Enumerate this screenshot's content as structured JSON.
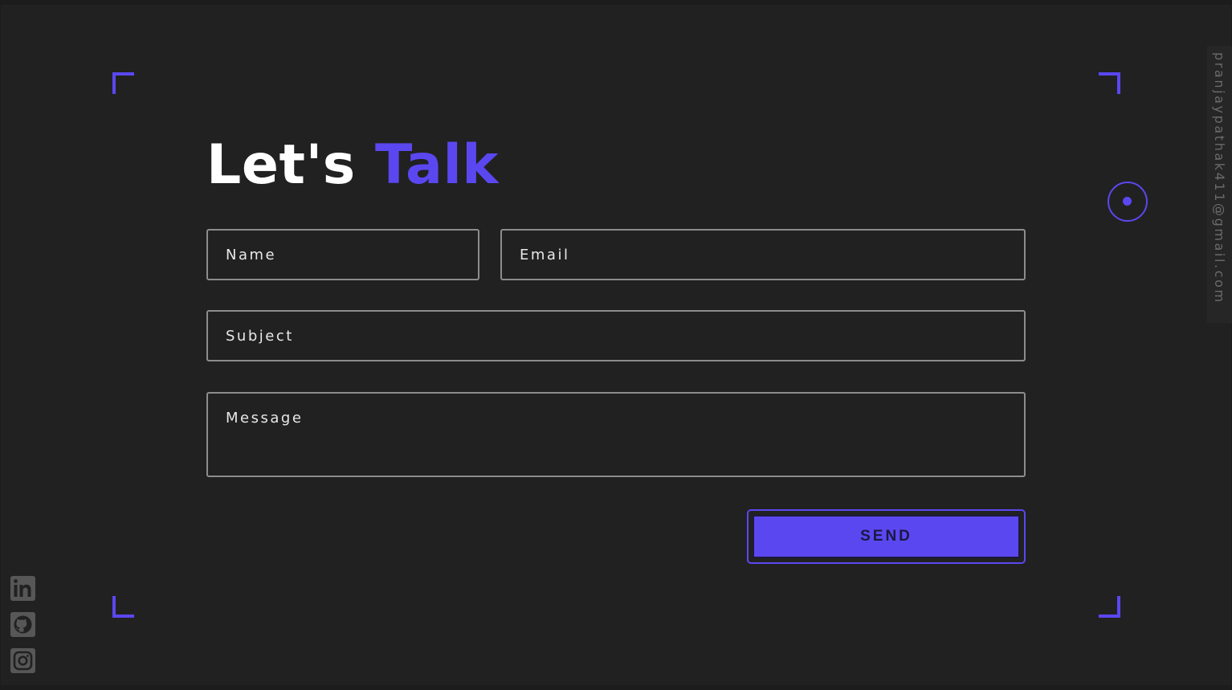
{
  "heading": {
    "part1": "Let's",
    "part2": "Talk"
  },
  "form": {
    "name_placeholder": "Name",
    "email_placeholder": "Email",
    "subject_placeholder": "Subject",
    "message_placeholder": "Message",
    "send_label": "SEND"
  },
  "sidebar": {
    "email": "pranjaypathak411@gmail.com"
  },
  "social": [
    {
      "icon": "linkedin-icon"
    },
    {
      "icon": "github-icon"
    },
    {
      "icon": "instagram-icon"
    }
  ],
  "colors": {
    "accent": "#5b47f0",
    "background": "#212121",
    "text": "#ffffff",
    "field_border": "#8c8c8c"
  }
}
